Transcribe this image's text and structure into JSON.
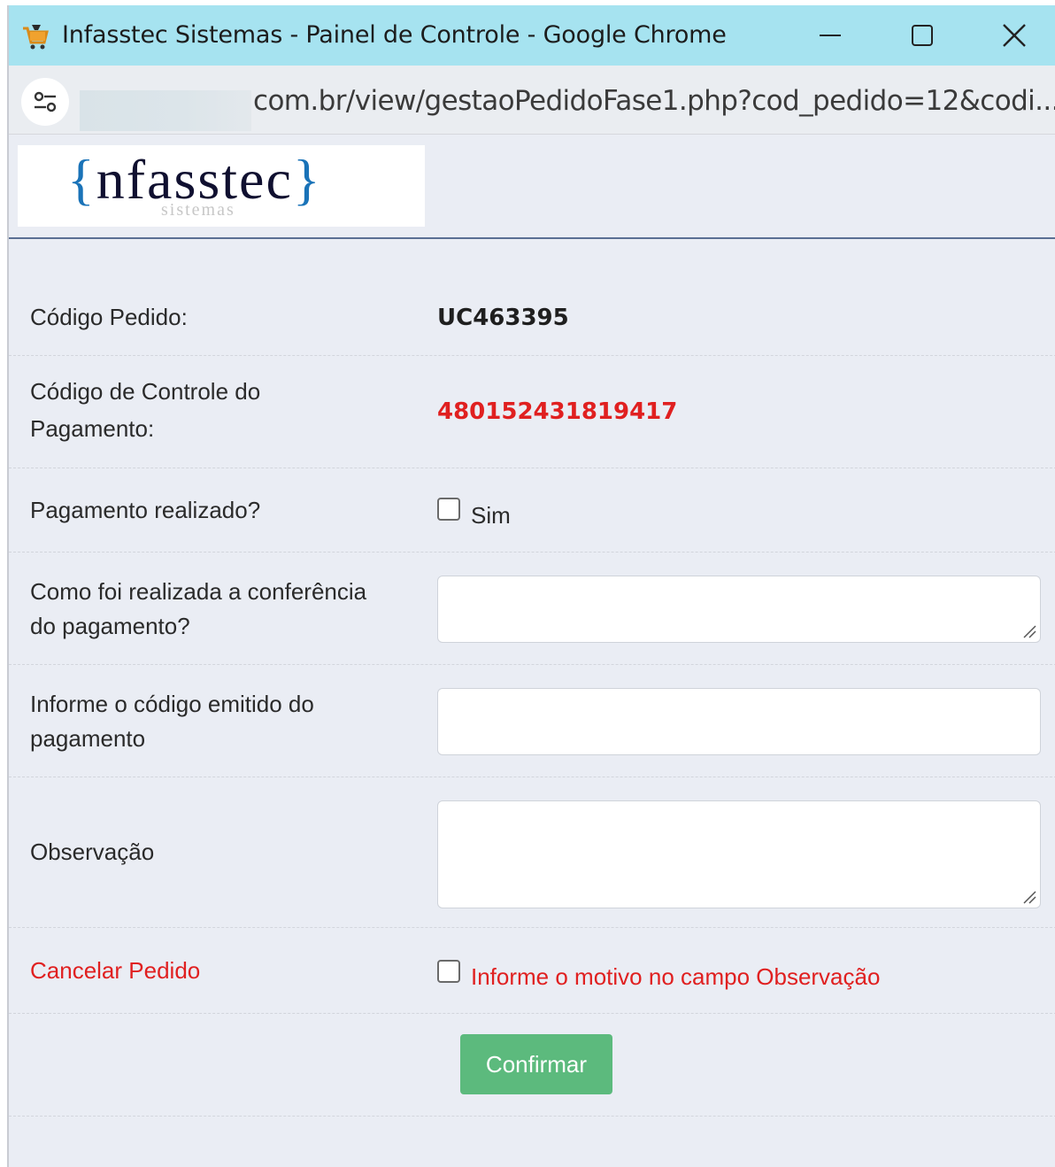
{
  "window": {
    "title": "Infasstec Sistemas - Painel de Controle - Google Chrome",
    "url_visible": "com.br/view/gestaoPedidoFase1.php?cod_pedido=12&codi..."
  },
  "header": {
    "logo_main": "nfasstec",
    "logo_sub": "sistemas"
  },
  "form": {
    "codigo_pedido_label": "Código Pedido:",
    "codigo_pedido_value": "UC463395",
    "controle_label_line1": "Código de Controle do",
    "controle_label_line2": "Pagamento:",
    "controle_value": "480152431819417",
    "pagamento_label": "Pagamento realizado?",
    "pagamento_option": "Sim",
    "conferencia_label_line1": "Como foi realizada a conferência",
    "conferencia_label_line2": "do pagamento?",
    "conferencia_value": "",
    "codigo_emitido_label_line1": "Informe o código emitido do",
    "codigo_emitido_label_line2": "pagamento",
    "codigo_emitido_value": "",
    "observacao_label": "Observação",
    "observacao_value": "",
    "cancelar_label": "Cancelar Pedido",
    "cancelar_hint": "Informe o motivo no campo Observação",
    "confirm_button": "Confirmar"
  },
  "colors": {
    "titlebar": "#a6e3f0",
    "accent_red": "#e02020",
    "confirm_green": "#5cba7d"
  }
}
